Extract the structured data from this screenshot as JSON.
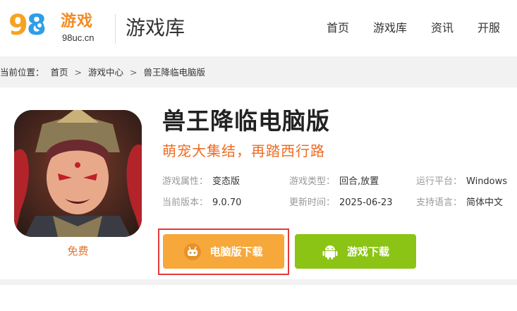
{
  "header": {
    "logo": {
      "brand_text": "游戏",
      "domain": "98uc.cn"
    },
    "title": "游戏库",
    "nav": [
      {
        "label": "首页"
      },
      {
        "label": "游戏库"
      },
      {
        "label": "资讯"
      },
      {
        "label": "开服"
      }
    ]
  },
  "breadcrumb": {
    "prefix": "当前位置：",
    "items": [
      "首页",
      "游戏中心",
      "兽王降临电脑版"
    ],
    "separator": ">"
  },
  "game": {
    "title": "兽王降临电脑版",
    "slogan": "萌宠大集结，再踏西行路",
    "price_label": "免费",
    "attributes": [
      [
        {
          "key": "游戏属性：",
          "value": "变态版"
        },
        {
          "key": "游戏类型：",
          "value": "回合,放置"
        },
        {
          "key": "运行平台：",
          "value": "Windows"
        }
      ],
      [
        {
          "key": "当前版本：",
          "value": "9.0.70"
        },
        {
          "key": "更新时间：",
          "value": "2025-06-23"
        },
        {
          "key": "支持语言：",
          "value": "简体中文"
        }
      ]
    ],
    "buttons": {
      "pc_download": "电脑版下载",
      "game_download": "游戏下载"
    }
  },
  "colors": {
    "accent_orange": "#f7a83a",
    "accent_green": "#8bc414",
    "slogan": "#ef6b22",
    "highlight_border": "#e53a3a"
  },
  "icons": {
    "pc_button_icon": "gamepad-robot-icon",
    "game_button_icon": "android-icon"
  }
}
